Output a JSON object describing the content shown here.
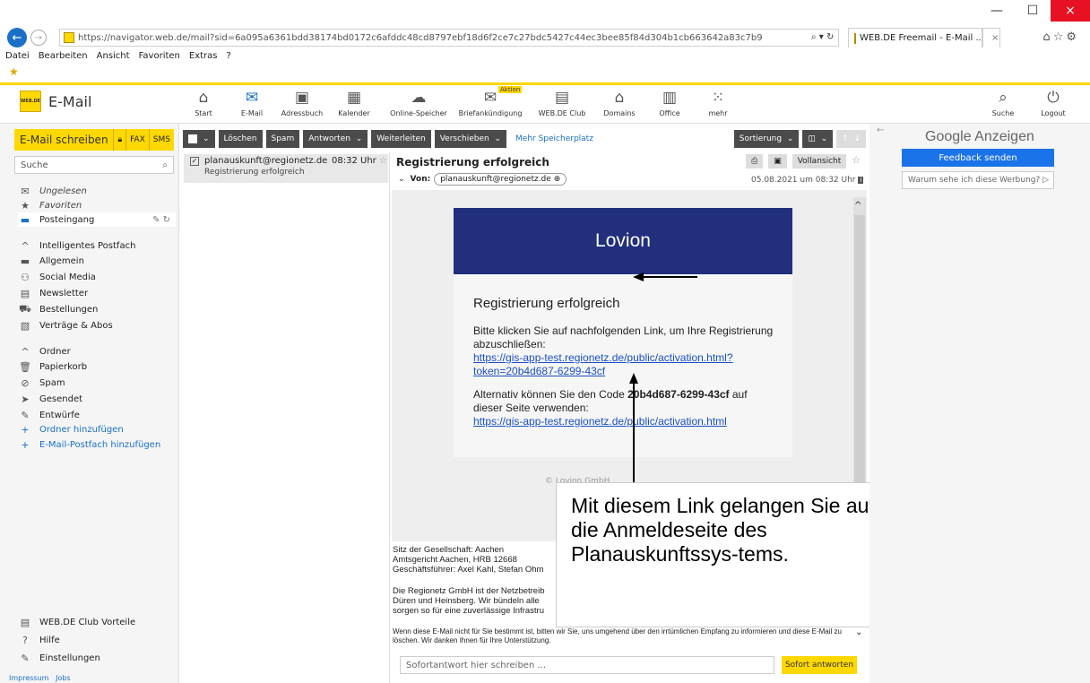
{
  "browser": {
    "url": "https://navigator.web.de/mail?sid=6a095a6361bdd38174bd0172c6afddc48cd8797ebf18d6f2ce7c27bdc5427c44ec3bee85f84d304b1cb663642a83c7b9",
    "url_controls": "⌕ ▾ ↻",
    "tab_title": "WEB.DE Freemail - E-Mail ...",
    "tab_close": "×",
    "menu": [
      "Datei",
      "Bearbeiten",
      "Ansicht",
      "Favoriten",
      "Extras",
      "?"
    ],
    "window_min": "—",
    "window_max": "☐",
    "window_close": "×"
  },
  "app": {
    "logo_text": "WEB.DE",
    "title": "E-Mail",
    "nav": [
      {
        "label": "Start",
        "icon": "home-icon"
      },
      {
        "label": "E-Mail",
        "icon": "mail-icon"
      },
      {
        "label": "Adressbuch",
        "icon": "addressbook-icon"
      },
      {
        "label": "Kalender",
        "icon": "calendar-icon"
      },
      {
        "label": "Online-Speicher",
        "icon": "cloud-icon"
      },
      {
        "label": "Briefankündigung",
        "icon": "letter-icon"
      },
      {
        "label": "WEB.DE Club",
        "icon": "club-icon"
      },
      {
        "label": "Domains",
        "icon": "domains-icon"
      },
      {
        "label": "Office",
        "icon": "office-icon"
      },
      {
        "label": "mehr",
        "icon": "grid-icon"
      }
    ],
    "nav_badge": "Aktion",
    "search_label": "Suche",
    "logout_label": "Logout"
  },
  "sidebar": {
    "compose": "E-Mail schreiben",
    "fax": "FAX",
    "sms": "SMS",
    "search_placeholder": "Suche",
    "quick": [
      {
        "label": "Ungelesen",
        "icon": "envelope-icon"
      },
      {
        "label": "Favoriten",
        "icon": "star-icon"
      },
      {
        "label": "Posteingang",
        "icon": "inbox-icon"
      }
    ],
    "smart_header": "Intelligentes Postfach",
    "smart": [
      {
        "label": "Allgemein",
        "icon": "inbox-icon"
      },
      {
        "label": "Social Media",
        "icon": "social-icon"
      },
      {
        "label": "Newsletter",
        "icon": "newsletter-icon"
      },
      {
        "label": "Bestellungen",
        "icon": "cart-icon"
      },
      {
        "label": "Verträge & Abos",
        "icon": "contract-icon"
      }
    ],
    "folders_header": "Ordner",
    "folders": [
      {
        "label": "Papierkorb",
        "icon": "trash-icon"
      },
      {
        "label": "Spam",
        "icon": "spam-icon"
      },
      {
        "label": "Gesendet",
        "icon": "sent-icon"
      },
      {
        "label": "Entwürfe",
        "icon": "draft-icon"
      }
    ],
    "add_folder": "Ordner hinzufügen",
    "add_mailbox": "E-Mail-Postfach hinzufügen",
    "bottom": [
      {
        "label": "WEB.DE Club Vorteile",
        "icon": "club-icon"
      },
      {
        "label": "Hilfe",
        "icon": "help-icon"
      },
      {
        "label": "Einstellungen",
        "icon": "settings-icon"
      }
    ],
    "footer_links": [
      "Impressum",
      "Jobs"
    ]
  },
  "toolbar": {
    "delete": "Löschen",
    "spam": "Spam",
    "reply": "Antworten",
    "forward": "Weiterleiten",
    "move": "Verschieben",
    "more_storage": "Mehr Speicherplatz",
    "sort": "Sortierung"
  },
  "maillist": {
    "items": [
      {
        "from": "planauskunft@regionetz.de",
        "time": "08:32 Uhr",
        "subject": "Registrierung erfolgreich"
      }
    ]
  },
  "message": {
    "subject": "Registrierung erfolgreich",
    "from_label": "Von:",
    "from": "planauskunft@regionetz.de",
    "fullview": "Vollansicht",
    "date": "05.08.2021 um 08:32 Uhr",
    "banner": "Lovion",
    "title": "Registrierung erfolgreich",
    "para1": "Bitte klicken Sie auf nachfolgenden Link, um Ihre Registrierung abzuschließen:",
    "link1_line1": "https://gis-app-test.regionetz.de/public/activation.html?",
    "link1_line2": "token=20b4d687-6299-43cf",
    "para2_a": "Alternativ können Sie den Code ",
    "code": "20b4d687-6299-43cf",
    "para2_b": " auf dieser Seite verwenden:",
    "link2": "https://gis-app-test.regionetz.de/public/activation.html",
    "card_footer": "© Lovion GmbH",
    "footer_lines": [
      "Sitz der Gesellschaft: Aachen",
      "Amtsgericht Aachen, HRB 12668",
      "Geschäftsführer: Axel Kahl, Stefan Ohm"
    ],
    "footer_lines2": [
      "Die Regionetz GmbH ist der Netzbetreib",
      "Düren und Heinsberg. Wir bündeln alle",
      "sorgen so für eine zuverlässige Infrastru"
    ],
    "disclaimer": "Wenn diese E-Mail nicht für Sie bestimmt ist, bitten wir Sie, uns umgehend über den irrtümlichen Empfang zu informieren und diese E-Mail zu löschen. Wir danken Ihnen für Ihre Unterstützung.",
    "reply_placeholder": "Sofortantwort hier schreiben ...",
    "reply_button": "Sofort antworten"
  },
  "annotation": {
    "text": "Mit diesem Link gelangen Sie auf die Anmeldeseite des Planauskunftssys-tems."
  },
  "ads": {
    "title": "Google Anzeigen",
    "feedback": "Feedback senden",
    "why": "Warum sehe ich diese Werbung? ▷"
  }
}
